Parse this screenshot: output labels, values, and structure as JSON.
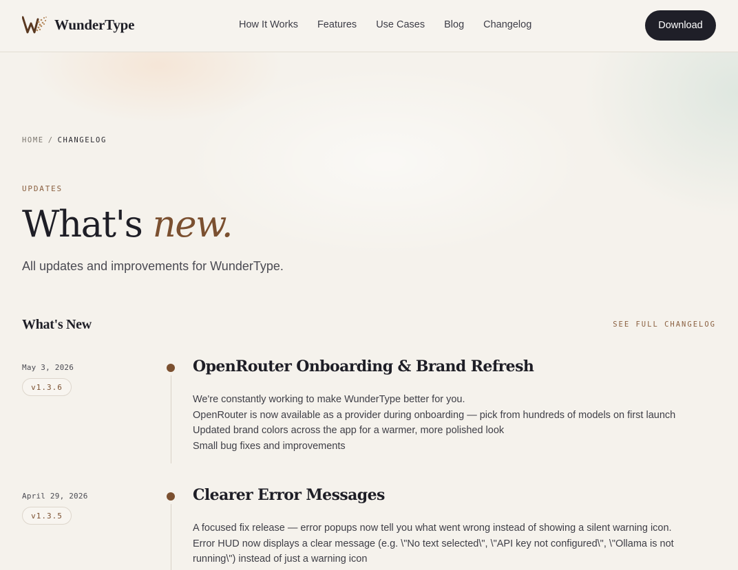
{
  "nav": {
    "brand": "WunderType",
    "links": [
      "How It Works",
      "Features",
      "Use Cases",
      "Blog",
      "Changelog"
    ],
    "download_label": "Download"
  },
  "breadcrumb": {
    "home": "HOME",
    "separator": "/",
    "current": "CHANGELOG"
  },
  "hero": {
    "eyebrow": "UPDATES",
    "title_start": "What's",
    "title_accent": "new.",
    "subtitle": "All updates and improvements for WunderType."
  },
  "section": {
    "title": "What's New",
    "full_link": "SEE FULL CHANGELOG"
  },
  "entries": [
    {
      "date": "May 3, 2026",
      "version": "v1.3.6",
      "title": "OpenRouter Onboarding & Brand Refresh",
      "items": [
        "We're constantly working to make WunderType better for you.",
        "OpenRouter is now available as a provider during onboarding — pick from hundreds of models on first launch",
        "Updated brand colors across the app for a warmer, more polished look",
        "Small bug fixes and improvements"
      ]
    },
    {
      "date": "April 29, 2026",
      "version": "v1.3.5",
      "title": "Clearer Error Messages",
      "items": [
        "A focused fix release — error popups now tell you what went wrong instead of showing a silent warning icon.",
        "Error HUD now displays a clear message (e.g. \\\"No text selected\\\", \\\"API key not configured\\\", \\\"Ollama is not running\\\") instead of just a warning icon"
      ]
    }
  ],
  "colors": {
    "accent": "#7b5030",
    "dark": "#1f1f28",
    "background": "#f5f2ec"
  }
}
